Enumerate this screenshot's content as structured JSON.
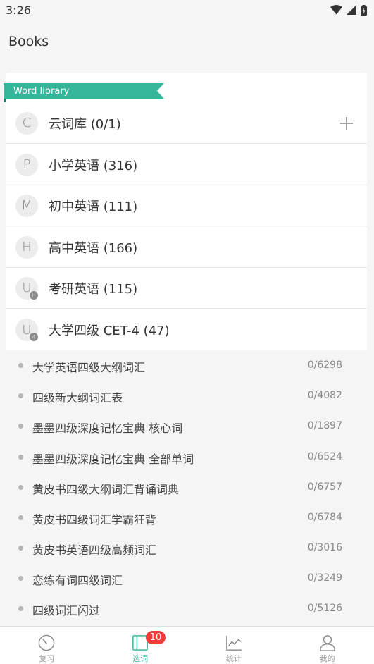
{
  "status_bar": {
    "time": "3:26"
  },
  "app_bar": {
    "title": "Books"
  },
  "word_library": {
    "ribbon_label": "Word library",
    "ribbon_color": "#35b59a",
    "libraries": [
      {
        "avatar": "C",
        "label": "云词库 (0/1)",
        "badge": ""
      },
      {
        "avatar": "P",
        "label": "小学英语 (316)",
        "badge": ""
      },
      {
        "avatar": "M",
        "label": "初中英语 (111)",
        "badge": ""
      },
      {
        "avatar": "H",
        "label": "高中英语 (166)",
        "badge": ""
      },
      {
        "avatar": "U",
        "label": "考研英语 (115)",
        "badge": "P"
      },
      {
        "avatar": "U",
        "label": "大学四级 CET-4 (47)",
        "badge": "4"
      }
    ]
  },
  "word_lists": [
    {
      "name": "大学英语四级大纲词汇",
      "count": "0/6298"
    },
    {
      "name": "四级新大纲词汇表",
      "count": "0/4082"
    },
    {
      "name": "墨墨四级深度记忆宝典 核心词",
      "count": "0/1897"
    },
    {
      "name": "墨墨四级深度记忆宝典 全部单词",
      "count": "0/6524"
    },
    {
      "name": "黄皮书四级大纲词汇背诵词典",
      "count": "0/6757"
    },
    {
      "name": "黄皮书四级词汇学霸狂背",
      "count": "0/6784"
    },
    {
      "name": "黄皮书英语四级高频词汇",
      "count": "0/3016"
    },
    {
      "name": "恋练有词四级词汇",
      "count": "0/3249"
    },
    {
      "name": "四级词汇闪过",
      "count": "0/5126"
    }
  ],
  "bottom_nav": {
    "items": [
      {
        "label": "复习",
        "icon": "review-gauge-icon"
      },
      {
        "label": "选词",
        "icon": "book-icon",
        "badge": "10"
      },
      {
        "label": "统计",
        "icon": "chart-icon"
      },
      {
        "label": "我的",
        "icon": "person-icon"
      }
    ],
    "active_color": "#35b59a",
    "badge_color": "#f23c3c"
  }
}
